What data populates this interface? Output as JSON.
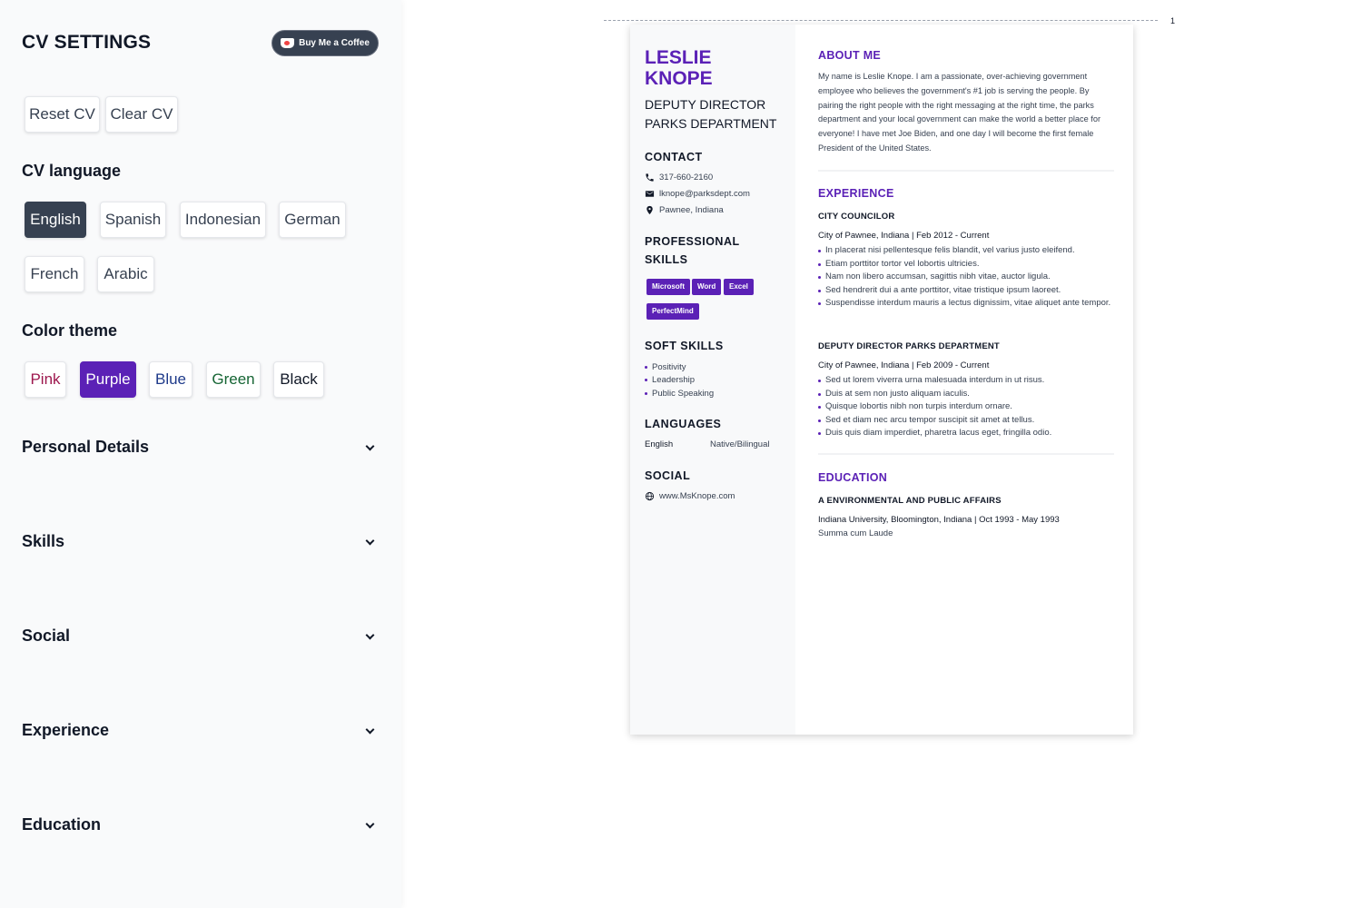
{
  "sidebar": {
    "title": "CV SETTINGS",
    "coffee_label": "Buy Me a Coffee",
    "reset_label": "Reset CV",
    "clear_label": "Clear CV",
    "language": {
      "title": "CV language",
      "options": [
        "English",
        "Spanish",
        "Indonesian",
        "German",
        "French",
        "Arabic"
      ],
      "selected": "English"
    },
    "theme": {
      "title": "Color theme",
      "options": [
        {
          "label": "Pink",
          "color": "#9d174d"
        },
        {
          "label": "Purple",
          "color": "#5b21b6"
        },
        {
          "label": "Blue",
          "color": "#1e3a8a"
        },
        {
          "label": "Green",
          "color": "#166534"
        },
        {
          "label": "Black",
          "color": "#111827"
        }
      ],
      "selected": "Purple"
    },
    "sections": [
      "Personal Details",
      "Skills",
      "Social",
      "Experience",
      "Education"
    ]
  },
  "cv": {
    "page_number": "1",
    "accent": "#5b21b6",
    "name_line1": "LESLIE",
    "name_line2": "KNOPE",
    "role_line1": "DEPUTY DIRECTOR",
    "role_line2": "PARKS DEPARTMENT",
    "contact": {
      "title": "CONTACT",
      "phone": "317-660-2160",
      "email": "lknope@parksdept.com",
      "location": "Pawnee, Indiana"
    },
    "professional_skills": {
      "title_line1": "PROFESSIONAL",
      "title_line2": "SKILLS",
      "items": [
        "Microsoft",
        "Word",
        "Excel",
        "PerfectMind"
      ]
    },
    "soft_skills": {
      "title": "SOFT SKILLS",
      "items": [
        "Positivity",
        "Leadership",
        "Public Speaking"
      ]
    },
    "languages": {
      "title": "LANGUAGES",
      "items": [
        {
          "name": "English",
          "level": "Native/Bilingual"
        }
      ]
    },
    "social": {
      "title": "SOCIAL",
      "website": "www.MsKnope.com"
    },
    "about": {
      "title": "ABOUT ME",
      "text": "My name is Leslie Knope. I am a passionate, over-achieving government employee who believes the government's #1 job is serving the people. By pairing the right people with the right messaging at the right time, the parks department and your local government can make the world a better place for everyone! I have met Joe Biden, and one day I will become the first female President of the United States."
    },
    "experience": {
      "title": "EXPERIENCE",
      "jobs": [
        {
          "title": "CITY COUNCILOR",
          "meta": "City of Pawnee, Indiana | Feb 2012 - Current",
          "bullets": [
            "In placerat nisi pellentesque felis blandit, vel varius justo eleifend.",
            "Etiam porttitor tortor vel lobortis ultricies.",
            "Nam non libero accumsan, sagittis nibh vitae, auctor ligula.",
            "Sed hendrerit dui a ante porttitor, vitae tristique ipsum laoreet.",
            "Suspendisse interdum mauris a lectus dignissim, vitae aliquet ante tempor."
          ]
        },
        {
          "title": "DEPUTY DIRECTOR PARKS DEPARTMENT",
          "meta": "City of Pawnee, Indiana | Feb 2009 - Current",
          "bullets": [
            "Sed ut lorem viverra urna malesuada interdum in ut risus.",
            "Duis at sem non justo aliquam iaculis.",
            "Quisque lobortis nibh non turpis interdum ornare.",
            "Sed et diam nec arcu tempor suscipit sit amet at tellus.",
            "Duis quis diam imperdiet, pharetra lacus eget, fringilla odio."
          ]
        }
      ]
    },
    "education": {
      "title": "EDUCATION",
      "degree": "A ENVIRONMENTAL AND PUBLIC AFFAIRS",
      "meta": "Indiana University, Bloomington, Indiana | Oct 1993 - May 1993",
      "note": "Summa cum Laude"
    }
  }
}
